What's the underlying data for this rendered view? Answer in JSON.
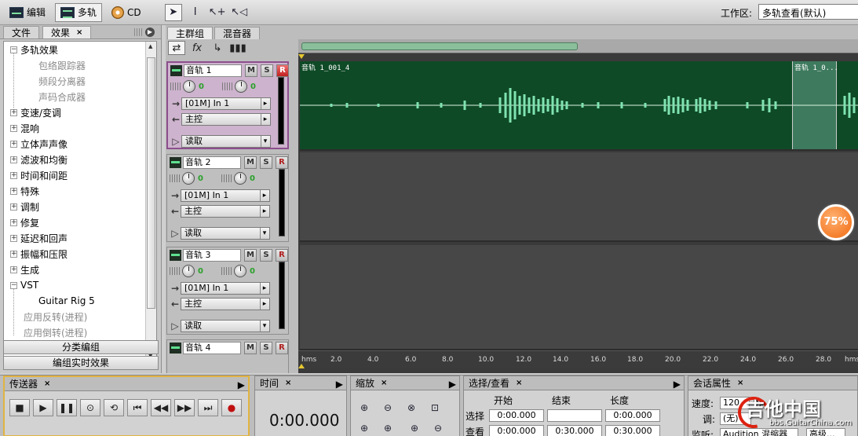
{
  "toolbar": {
    "modes": [
      {
        "label": "编辑",
        "icon": "waveform-editor-icon"
      },
      {
        "label": "多轨",
        "icon": "multitrack-icon"
      },
      {
        "label": "CD",
        "icon": "cd-icon"
      }
    ],
    "workspace_label": "工作区:",
    "workspace_value": "多轨查看(默认)"
  },
  "left_panel": {
    "tabs": [
      "文件",
      "效果"
    ],
    "tree": [
      {
        "label": "多轨效果",
        "expanded": true
      },
      {
        "label": "包络跟踪器",
        "child": true
      },
      {
        "label": "频段分离器",
        "child": true
      },
      {
        "label": "声码合成器",
        "child": true
      },
      {
        "label": "变速/变调"
      },
      {
        "label": "混响"
      },
      {
        "label": "立体声声像"
      },
      {
        "label": "滤波和均衡"
      },
      {
        "label": "时间和间距"
      },
      {
        "label": "特殊"
      },
      {
        "label": "调制"
      },
      {
        "label": "修复"
      },
      {
        "label": "延迟和回声"
      },
      {
        "label": "振幅和压限"
      },
      {
        "label": "生成"
      },
      {
        "label": "VST",
        "expanded": true
      },
      {
        "label": "Guitar Rig 5",
        "child": true,
        "selected": true
      },
      {
        "label": "应用反转(进程)",
        "gray": true
      },
      {
        "label": "应用倒转(进程)",
        "gray": true
      }
    ],
    "btn_group": "分类编组",
    "btn_realtime": "编组实时效果"
  },
  "main_tabs": [
    "主群组",
    "混音器"
  ],
  "tracks": [
    {
      "name": "音轨 1",
      "vol": "0",
      "pan": "0",
      "input": "[01M] In 1",
      "output": "主控",
      "mode": "读取",
      "selected": true
    },
    {
      "name": "音轨 2",
      "vol": "0",
      "pan": "0",
      "input": "[01M] In 1",
      "output": "主控",
      "mode": "读取"
    },
    {
      "name": "音轨 3",
      "vol": "0",
      "pan": "0",
      "input": "[01M] In 1",
      "output": "主控",
      "mode": "读取"
    },
    {
      "name": "音轨 4"
    }
  ],
  "track_buttons": {
    "m": "M",
    "s": "S",
    "r": "R"
  },
  "clips": {
    "main": "音轨 1_001_4",
    "second": "音轨 1_0..."
  },
  "ruler": {
    "unit": "hms",
    "ticks": [
      "2.0",
      "4.0",
      "6.0",
      "8.0",
      "10.0",
      "12.0",
      "14.0",
      "16.0",
      "18.0",
      "20.0",
      "22.0",
      "24.0",
      "26.0",
      "28.0"
    ]
  },
  "zoom_badge": "75%",
  "bottom": {
    "transport": {
      "title": "传送器"
    },
    "time": {
      "title": "时间",
      "value": "0:00.000"
    },
    "zoom": {
      "title": "缩放"
    },
    "selection": {
      "title": "选择/查看",
      "headers": [
        "开始",
        "结束",
        "长度"
      ],
      "row_sel": "选择",
      "row_view": "查看",
      "sel_start": "0:00.000",
      "sel_end": "",
      "sel_len": "0:00.000",
      "view_start": "0:00.000",
      "view_end": "0:30.000",
      "view_len": "0:30.000"
    },
    "session": {
      "title": "会话属性",
      "speed_label": "速度:",
      "speed_value": "120",
      "speed_unit": "bp",
      "key_label": "调:",
      "key_value": "(无)",
      "monitor_label": "监听:",
      "monitor_value": "Audition 混缩器",
      "advanced": "高级..."
    }
  },
  "watermark": {
    "main": "吉他中国",
    "sub": "bbs.GuitarChina.com"
  }
}
